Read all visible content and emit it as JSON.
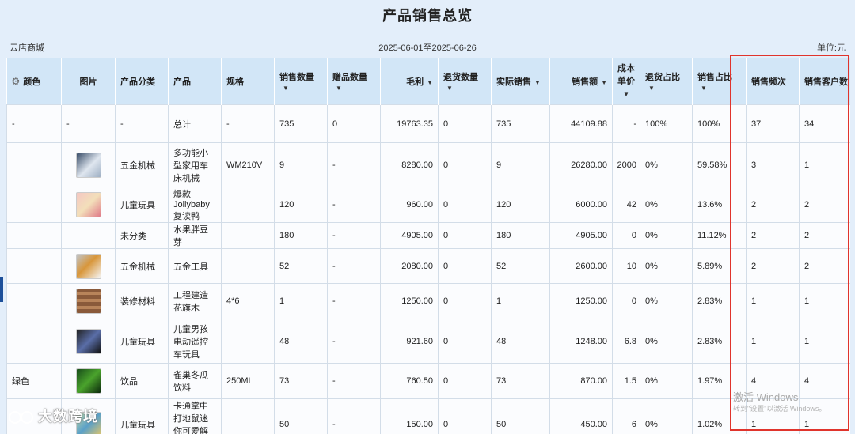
{
  "title": "产品销售总览",
  "store": "云店商城",
  "date_range": "2025-06-01至2025-06-26",
  "unit": "单位:元",
  "columns": [
    "颜色",
    "图片",
    "产品分类",
    "产品",
    "规格",
    "销售数量",
    "赠品数量",
    "毛利",
    "退货数量",
    "实际销售",
    "销售额",
    "成本单价",
    "退货占比",
    "销售占比",
    "销售频次",
    "销售客户数"
  ],
  "rows": [
    {
      "color": "-",
      "img": "-",
      "category": "-",
      "product": "总计",
      "spec": "-",
      "qty": "735",
      "gift": "0",
      "profit": "19763.35",
      "ret": "0",
      "actual": "735",
      "sales": "44109.88",
      "cost": "-",
      "ret_pct": "100%",
      "sales_pct": "100%",
      "freq": "37",
      "cust": "34"
    },
    {
      "color": "",
      "img": "tp1",
      "category": "五金机械",
      "product": "多功能小型家用车床机械",
      "spec": "WM210V",
      "qty": "9",
      "gift": "-",
      "profit": "8280.00",
      "ret": "0",
      "actual": "9",
      "sales": "26280.00",
      "cost": "2000",
      "ret_pct": "0%",
      "sales_pct": "59.58%",
      "freq": "3",
      "cust": "1"
    },
    {
      "color": "",
      "img": "tp2",
      "category": "儿童玩具",
      "product": "爆款Jollybaby复读鸭",
      "spec": "",
      "qty": "120",
      "gift": "-",
      "profit": "960.00",
      "ret": "0",
      "actual": "120",
      "sales": "6000.00",
      "cost": "42",
      "ret_pct": "0%",
      "sales_pct": "13.6%",
      "freq": "2",
      "cust": "2"
    },
    {
      "color": "",
      "img": "",
      "category": "未分类",
      "product": "水果胖豆芽",
      "spec": "",
      "qty": "180",
      "gift": "-",
      "profit": "4905.00",
      "ret": "0",
      "actual": "180",
      "sales": "4905.00",
      "cost": "0",
      "ret_pct": "0%",
      "sales_pct": "11.12%",
      "freq": "2",
      "cust": "2"
    },
    {
      "color": "",
      "img": "tp3",
      "category": "五金机械",
      "product": "五金工具",
      "spec": "",
      "qty": "52",
      "gift": "-",
      "profit": "2080.00",
      "ret": "0",
      "actual": "52",
      "sales": "2600.00",
      "cost": "10",
      "ret_pct": "0%",
      "sales_pct": "5.89%",
      "freq": "2",
      "cust": "2"
    },
    {
      "color": "",
      "img": "tp4",
      "category": "装修材料",
      "product": "工程建造花旗木",
      "spec": "4*6",
      "qty": "1",
      "gift": "-",
      "profit": "1250.00",
      "ret": "0",
      "actual": "1",
      "sales": "1250.00",
      "cost": "0",
      "ret_pct": "0%",
      "sales_pct": "2.83%",
      "freq": "1",
      "cust": "1"
    },
    {
      "color": "",
      "img": "tp5",
      "category": "儿童玩具",
      "product": "儿童男孩电动遥控车玩具",
      "spec": "",
      "qty": "48",
      "gift": "-",
      "profit": "921.60",
      "ret": "0",
      "actual": "48",
      "sales": "1248.00",
      "cost": "6.8",
      "ret_pct": "0%",
      "sales_pct": "2.83%",
      "freq": "1",
      "cust": "1"
    },
    {
      "color": "绿色",
      "img": "tp6",
      "category": "饮品",
      "product": "雀巢冬瓜饮料",
      "spec": "250ML",
      "qty": "73",
      "gift": "-",
      "profit": "760.50",
      "ret": "0",
      "actual": "73",
      "sales": "870.00",
      "cost": "1.5",
      "ret_pct": "0%",
      "sales_pct": "1.97%",
      "freq": "4",
      "cust": "4"
    },
    {
      "color": "",
      "img": "tp7",
      "category": "儿童玩具",
      "product": "卡通掌中打地鼠迷你可爱解压玩具",
      "spec": "",
      "qty": "50",
      "gift": "-",
      "profit": "150.00",
      "ret": "0",
      "actual": "50",
      "sales": "450.00",
      "cost": "6",
      "ret_pct": "0%",
      "sales_pct": "1.02%",
      "freq": "1",
      "cust": "1"
    }
  ],
  "watermark": {
    "line1": "激活 Windows",
    "line2": "转到\"设置\"以激活 Windows。"
  },
  "brand": "大数跨境"
}
